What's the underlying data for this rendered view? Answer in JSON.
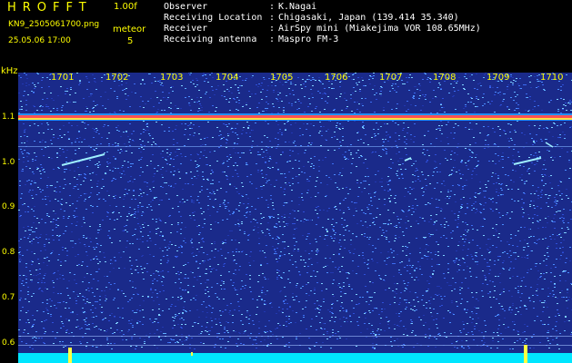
{
  "header": {
    "logo": "HROFFT",
    "version": "1.00f",
    "file_name": "KN9_2505061700.png",
    "date_time": "25.05.06 17:00",
    "meteor_label": "meteor",
    "meteor_count": "5"
  },
  "info": [
    {
      "label": "Observer",
      "value": "K.Nagai"
    },
    {
      "label": "Receiving Location",
      "value": "Chigasaki, Japan (139.414 35.340)"
    },
    {
      "label": "Receiver",
      "value": "AirSpy mini (Miakejima VOR 108.65MHz)"
    },
    {
      "label": "Receiving antenna",
      "value": "Maspro FM-3"
    }
  ],
  "spectrogram": {
    "unit": "kHz",
    "y_labels": [
      "1.1",
      "1.0",
      "0.9",
      "0.8",
      "0.7",
      "0.6"
    ],
    "x_labels": [
      "1701",
      "1702",
      "1703",
      "1704",
      "1705",
      "1706",
      "1707",
      "1708",
      "1709",
      "1710"
    ],
    "background_color": "#1a2a8a",
    "accent_color": "#ffff00"
  }
}
